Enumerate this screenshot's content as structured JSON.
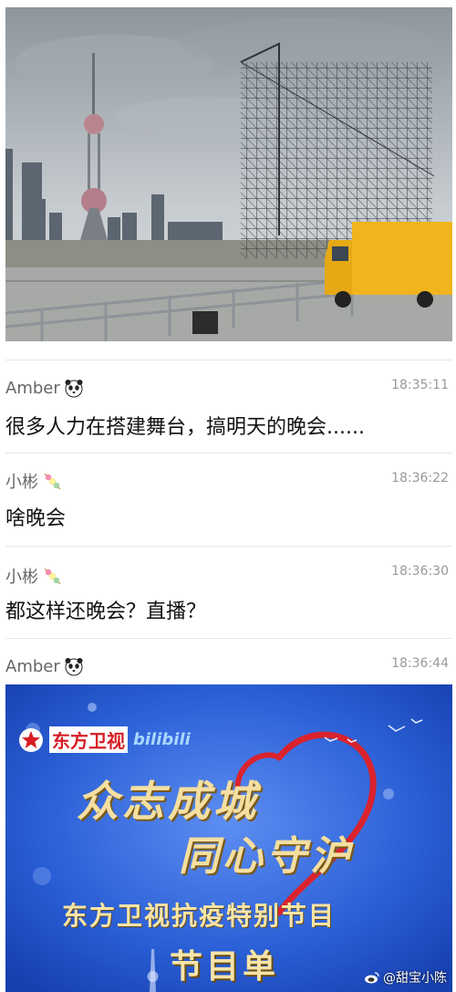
{
  "messages": [
    {
      "sender": "Amber",
      "time": "18:35:11",
      "text": "很多人力在搭建舞台，搞明天的晚会......",
      "emoji": "panda-icon"
    },
    {
      "sender": "小彬",
      "time": "18:36:22",
      "text": "啥晚会",
      "emoji": "skewer-icon"
    },
    {
      "sender": "小彬",
      "time": "18:36:30",
      "text": "都这样还晚会？直播？",
      "emoji": "skewer-icon"
    },
    {
      "sender": "Amber",
      "time": "18:36:44",
      "text": "",
      "emoji": "panda-icon"
    }
  ],
  "poster": {
    "channel_logo": "东方卫视",
    "bilibili": "bilibili",
    "line1": "众志成城",
    "line2": "同心守沪",
    "subtitle": "东方卫视抗疫特别节目",
    "program": "节目单"
  },
  "watermark": "@甜宝小陈",
  "colors": {
    "poster_bg": "#1e4fc9",
    "heart": "#d9232d",
    "logo_red": "#d71c24",
    "gold": "#e8c76a"
  }
}
